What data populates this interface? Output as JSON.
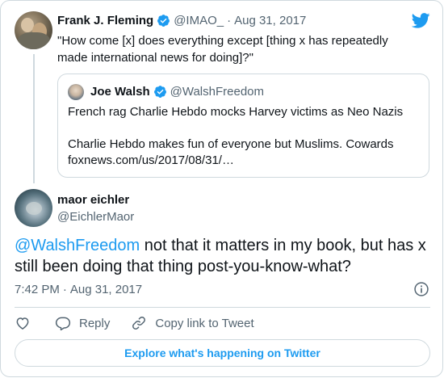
{
  "parent_tweet": {
    "author_name": "Frank J. Fleming",
    "handle": "@IMAO_",
    "separator": "·",
    "date": "Aug 31, 2017",
    "text": "\"How come [x] does everything except [thing x has repeatedly made international news for doing]?\""
  },
  "quoted_tweet": {
    "author_name": "Joe Walsh",
    "handle": "@WalshFreedom",
    "line1": "French rag Charlie Hebdo mocks Harvey victims as Neo Nazis",
    "line2": "Charlie Hebdo makes fun of everyone but Muslims. Cowards",
    "link": "foxnews.com/us/2017/08/31/…"
  },
  "main_tweet": {
    "author_name": "maor eichler",
    "handle": "@EichlerMaor",
    "mention": "@WalshFreedom",
    "text": " not that it matters in my book, but has x still been doing that thing post-you-know-what?",
    "time": "7:42 PM",
    "separator": "·",
    "date": "Aug 31, 2017"
  },
  "actions": {
    "reply_label": "Reply",
    "copy_link_label": "Copy link to Tweet"
  },
  "explore_label": "Explore what's happening on Twitter",
  "colors": {
    "accent": "#1d9bf0",
    "text_primary": "#0f1419",
    "text_secondary": "#536471",
    "border": "#cfd9de"
  },
  "icons": {
    "brand": "twitter-bird-icon",
    "verified": "verified-badge-icon",
    "info": "info-icon",
    "like": "heart-icon",
    "reply": "reply-bubble-icon",
    "copy_link": "link-icon"
  }
}
